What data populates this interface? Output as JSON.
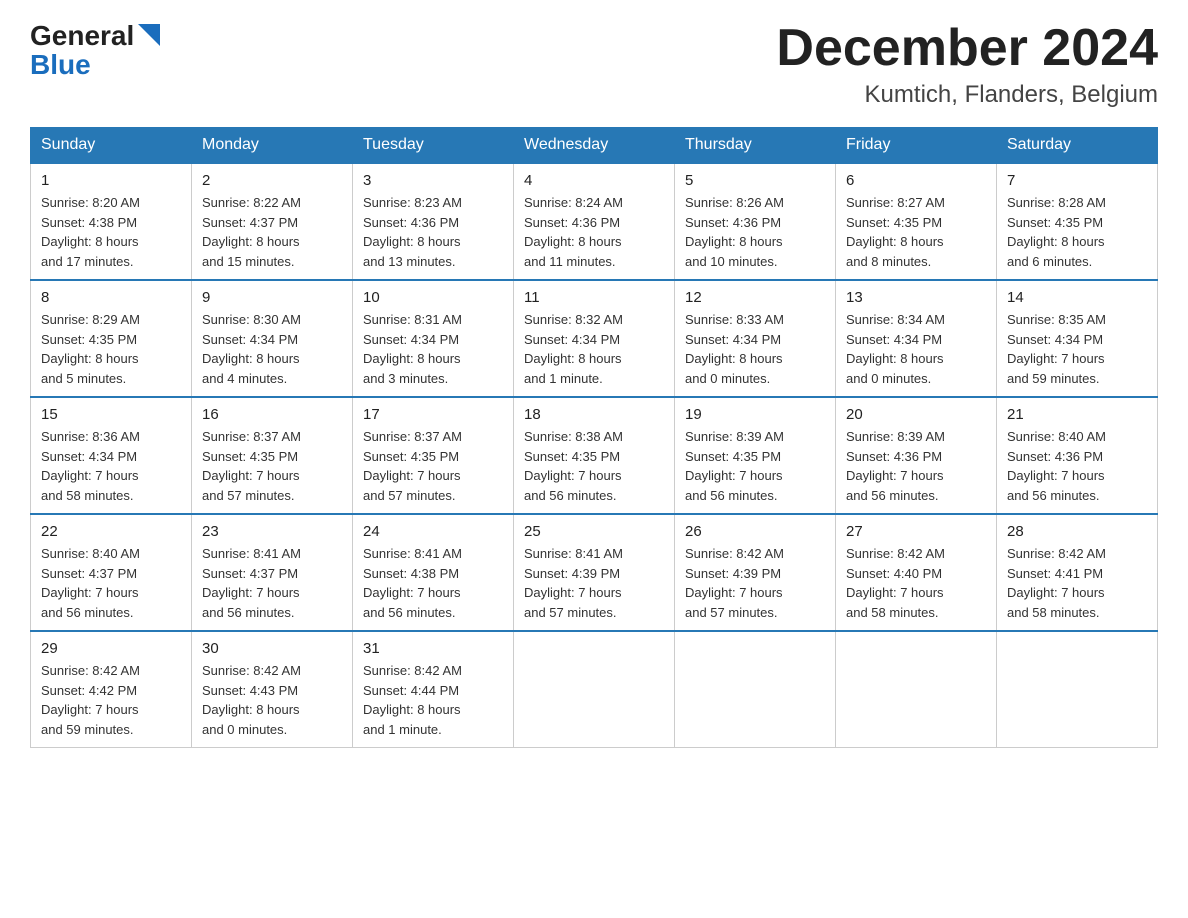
{
  "logo": {
    "general": "General",
    "blue": "Blue"
  },
  "title": {
    "month": "December 2024",
    "location": "Kumtich, Flanders, Belgium"
  },
  "days_of_week": [
    "Sunday",
    "Monday",
    "Tuesday",
    "Wednesday",
    "Thursday",
    "Friday",
    "Saturday"
  ],
  "weeks": [
    [
      {
        "day": "1",
        "info": "Sunrise: 8:20 AM\nSunset: 4:38 PM\nDaylight: 8 hours\nand 17 minutes."
      },
      {
        "day": "2",
        "info": "Sunrise: 8:22 AM\nSunset: 4:37 PM\nDaylight: 8 hours\nand 15 minutes."
      },
      {
        "day": "3",
        "info": "Sunrise: 8:23 AM\nSunset: 4:36 PM\nDaylight: 8 hours\nand 13 minutes."
      },
      {
        "day": "4",
        "info": "Sunrise: 8:24 AM\nSunset: 4:36 PM\nDaylight: 8 hours\nand 11 minutes."
      },
      {
        "day": "5",
        "info": "Sunrise: 8:26 AM\nSunset: 4:36 PM\nDaylight: 8 hours\nand 10 minutes."
      },
      {
        "day": "6",
        "info": "Sunrise: 8:27 AM\nSunset: 4:35 PM\nDaylight: 8 hours\nand 8 minutes."
      },
      {
        "day": "7",
        "info": "Sunrise: 8:28 AM\nSunset: 4:35 PM\nDaylight: 8 hours\nand 6 minutes."
      }
    ],
    [
      {
        "day": "8",
        "info": "Sunrise: 8:29 AM\nSunset: 4:35 PM\nDaylight: 8 hours\nand 5 minutes."
      },
      {
        "day": "9",
        "info": "Sunrise: 8:30 AM\nSunset: 4:34 PM\nDaylight: 8 hours\nand 4 minutes."
      },
      {
        "day": "10",
        "info": "Sunrise: 8:31 AM\nSunset: 4:34 PM\nDaylight: 8 hours\nand 3 minutes."
      },
      {
        "day": "11",
        "info": "Sunrise: 8:32 AM\nSunset: 4:34 PM\nDaylight: 8 hours\nand 1 minute."
      },
      {
        "day": "12",
        "info": "Sunrise: 8:33 AM\nSunset: 4:34 PM\nDaylight: 8 hours\nand 0 minutes."
      },
      {
        "day": "13",
        "info": "Sunrise: 8:34 AM\nSunset: 4:34 PM\nDaylight: 8 hours\nand 0 minutes."
      },
      {
        "day": "14",
        "info": "Sunrise: 8:35 AM\nSunset: 4:34 PM\nDaylight: 7 hours\nand 59 minutes."
      }
    ],
    [
      {
        "day": "15",
        "info": "Sunrise: 8:36 AM\nSunset: 4:34 PM\nDaylight: 7 hours\nand 58 minutes."
      },
      {
        "day": "16",
        "info": "Sunrise: 8:37 AM\nSunset: 4:35 PM\nDaylight: 7 hours\nand 57 minutes."
      },
      {
        "day": "17",
        "info": "Sunrise: 8:37 AM\nSunset: 4:35 PM\nDaylight: 7 hours\nand 57 minutes."
      },
      {
        "day": "18",
        "info": "Sunrise: 8:38 AM\nSunset: 4:35 PM\nDaylight: 7 hours\nand 56 minutes."
      },
      {
        "day": "19",
        "info": "Sunrise: 8:39 AM\nSunset: 4:35 PM\nDaylight: 7 hours\nand 56 minutes."
      },
      {
        "day": "20",
        "info": "Sunrise: 8:39 AM\nSunset: 4:36 PM\nDaylight: 7 hours\nand 56 minutes."
      },
      {
        "day": "21",
        "info": "Sunrise: 8:40 AM\nSunset: 4:36 PM\nDaylight: 7 hours\nand 56 minutes."
      }
    ],
    [
      {
        "day": "22",
        "info": "Sunrise: 8:40 AM\nSunset: 4:37 PM\nDaylight: 7 hours\nand 56 minutes."
      },
      {
        "day": "23",
        "info": "Sunrise: 8:41 AM\nSunset: 4:37 PM\nDaylight: 7 hours\nand 56 minutes."
      },
      {
        "day": "24",
        "info": "Sunrise: 8:41 AM\nSunset: 4:38 PM\nDaylight: 7 hours\nand 56 minutes."
      },
      {
        "day": "25",
        "info": "Sunrise: 8:41 AM\nSunset: 4:39 PM\nDaylight: 7 hours\nand 57 minutes."
      },
      {
        "day": "26",
        "info": "Sunrise: 8:42 AM\nSunset: 4:39 PM\nDaylight: 7 hours\nand 57 minutes."
      },
      {
        "day": "27",
        "info": "Sunrise: 8:42 AM\nSunset: 4:40 PM\nDaylight: 7 hours\nand 58 minutes."
      },
      {
        "day": "28",
        "info": "Sunrise: 8:42 AM\nSunset: 4:41 PM\nDaylight: 7 hours\nand 58 minutes."
      }
    ],
    [
      {
        "day": "29",
        "info": "Sunrise: 8:42 AM\nSunset: 4:42 PM\nDaylight: 7 hours\nand 59 minutes."
      },
      {
        "day": "30",
        "info": "Sunrise: 8:42 AM\nSunset: 4:43 PM\nDaylight: 8 hours\nand 0 minutes."
      },
      {
        "day": "31",
        "info": "Sunrise: 8:42 AM\nSunset: 4:44 PM\nDaylight: 8 hours\nand 1 minute."
      },
      {
        "day": "",
        "info": ""
      },
      {
        "day": "",
        "info": ""
      },
      {
        "day": "",
        "info": ""
      },
      {
        "day": "",
        "info": ""
      }
    ]
  ]
}
